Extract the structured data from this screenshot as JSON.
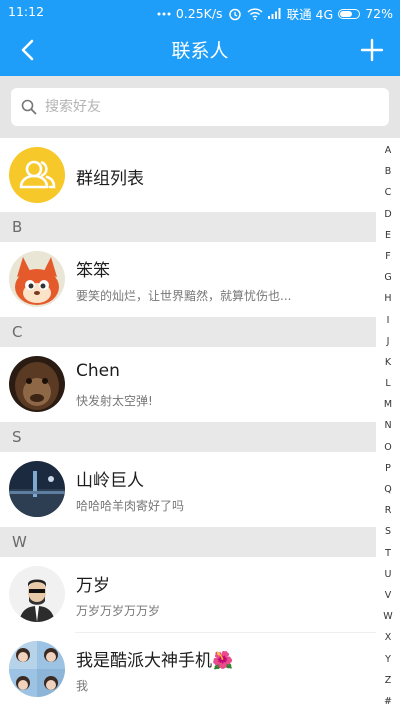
{
  "status_bar": {
    "time": "11:12",
    "speed": "0.25K/s",
    "carrier": "联通 4G",
    "battery": "72%",
    "battery_level": 0.72
  },
  "header": {
    "title": "联系人"
  },
  "search": {
    "placeholder": "搜索好友"
  },
  "group_list": {
    "label": "群组列表"
  },
  "sections": [
    {
      "letter": "B",
      "contacts": [
        {
          "name": "笨笨",
          "signature": "要笑的灿烂，让世界黯然，就算忧伤也..."
        }
      ]
    },
    {
      "letter": "C",
      "contacts": [
        {
          "name": "Chen",
          "signature": "快发射太空弹!"
        }
      ]
    },
    {
      "letter": "S",
      "contacts": [
        {
          "name": "山岭巨人",
          "signature": "哈哈哈羊肉寄好了吗"
        }
      ]
    },
    {
      "letter": "W",
      "contacts": [
        {
          "name": "万岁",
          "signature": "万岁万岁万万岁"
        },
        {
          "name": "我是酷派大神手机🌺",
          "signature": "我"
        }
      ]
    }
  ],
  "alphabet_index": [
    "A",
    "B",
    "C",
    "D",
    "E",
    "F",
    "G",
    "H",
    "I",
    "J",
    "K",
    "L",
    "M",
    "N",
    "O",
    "P",
    "Q",
    "R",
    "S",
    "T",
    "U",
    "V",
    "W",
    "X",
    "Y",
    "Z",
    "#"
  ],
  "colors": {
    "brand": "#1e9ef8",
    "group_icon_bg": "#f7c82a"
  }
}
